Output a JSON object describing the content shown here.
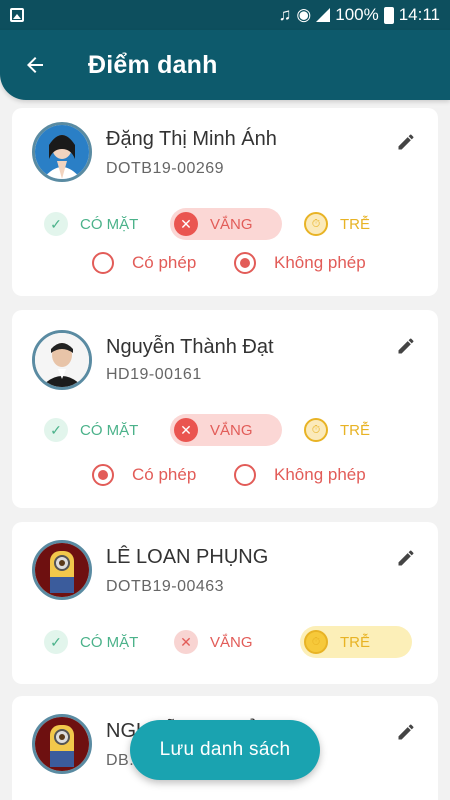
{
  "status_bar": {
    "battery": "100%",
    "time": "14:11"
  },
  "app_bar": {
    "title": "Điểm danh"
  },
  "labels": {
    "present": "CÓ MẶT",
    "absent": "VẮNG",
    "late": "TRỄ",
    "excused": "Có phép",
    "unexcused": "Không phép"
  },
  "students": [
    {
      "name": "Đặng Thị Minh Ánh",
      "code": "DOTB19-00269",
      "status": "absent",
      "reason": "unexcused"
    },
    {
      "name": "Nguyễn Thành Đạt",
      "code": "HD19-00161",
      "status": "absent",
      "reason": "excused"
    },
    {
      "name": "LÊ LOAN PHỤNG",
      "code": "DOTB19-00463",
      "status": "late"
    },
    {
      "name": "NGUYỄN ... THẢO",
      "code": "DB..."
    }
  ],
  "fab": {
    "label": "Lưu danh sách"
  },
  "colors": {
    "primary": "#0d5a6c",
    "accent": "#1aa3b0",
    "present": "#4bb28a",
    "absent": "#e25c58",
    "late": "#e8b325"
  }
}
